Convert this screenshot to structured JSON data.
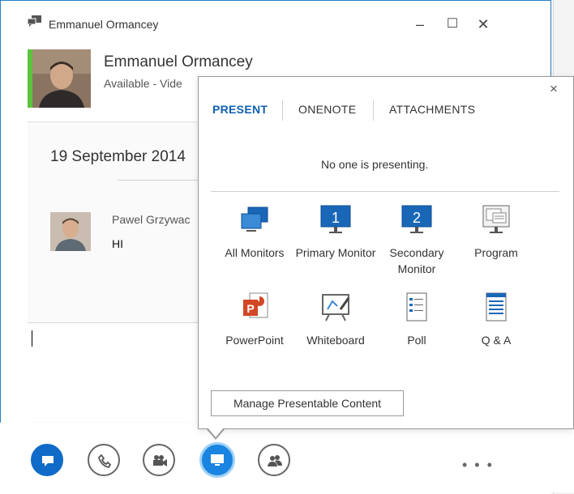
{
  "window": {
    "title": "Emmanuel Ormancey",
    "minimize_glyph": "–",
    "maximize_glyph": "☐",
    "close_glyph": "✕"
  },
  "contact": {
    "name": "Emmanuel Ormancey",
    "status": "Available - Vide",
    "presence_color": "#5cc43a"
  },
  "conversation": {
    "date": "19 September 2014",
    "messages": [
      {
        "sender": "Pawel Grzywac",
        "text": "HI"
      }
    ]
  },
  "present_popup": {
    "close_glyph": "×",
    "tabs": [
      {
        "label": "PRESENT",
        "active": true
      },
      {
        "label": "ONENOTE",
        "active": false
      },
      {
        "label": "ATTACHMENTS",
        "active": false
      }
    ],
    "status_text": "No one is presenting.",
    "items": [
      {
        "label": "All Monitors",
        "icon": "all-monitors-icon"
      },
      {
        "label": "Primary Monitor",
        "icon": "primary-monitor-icon",
        "badge": "1"
      },
      {
        "label": "Secondary Monitor",
        "icon": "secondary-monitor-icon",
        "badge": "2"
      },
      {
        "label": "Program",
        "icon": "program-icon"
      },
      {
        "label": "PowerPoint",
        "icon": "powerpoint-icon"
      },
      {
        "label": "Whiteboard",
        "icon": "whiteboard-icon"
      },
      {
        "label": "Poll",
        "icon": "poll-icon"
      },
      {
        "label": "Q & A",
        "icon": "qa-icon"
      }
    ],
    "manage_button": "Manage Presentable Content"
  },
  "toolbar": {
    "more_glyph": "• • •",
    "buttons": [
      "im-icon",
      "call-icon",
      "video-icon",
      "present-icon",
      "participants-icon"
    ]
  },
  "colors": {
    "accent": "#0f6bc7",
    "tab_active": "#0f5fb0",
    "monitor_blue": "#1a67b8"
  }
}
